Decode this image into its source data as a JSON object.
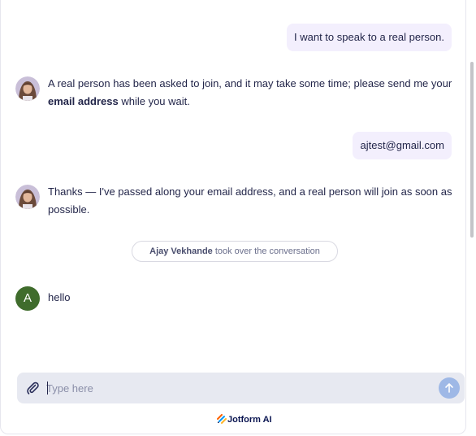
{
  "messages": [
    {
      "sender": "user",
      "text": "I want to speak to a real person."
    },
    {
      "sender": "bot",
      "text_before": "A real person has been asked to join, and it may take some time; please send me your ",
      "text_bold": "email address",
      "text_after": " while you wait."
    },
    {
      "sender": "user",
      "text": "ajtest@gmail.com"
    },
    {
      "sender": "bot",
      "text": "Thanks — I've passed along your email address, and a real person will join as soon as possible."
    },
    {
      "sender": "system",
      "agent_name": "Ajay Vekhande",
      "text": " took over the conversation"
    },
    {
      "sender": "agent",
      "avatar_letter": "A",
      "text": "hello"
    }
  ],
  "composer": {
    "placeholder": "Type here",
    "value": ""
  },
  "footer": {
    "brand": "Jotform AI"
  },
  "icons": {
    "attach": "paperclip-icon",
    "send": "arrow-up-icon",
    "bot_avatar": "bot-avatar-photo",
    "brand_logo": "jotform-logo"
  },
  "colors": {
    "user_bubble": "#f3effd",
    "text": "#23264a",
    "agent_avatar": "#3f6c2c",
    "composer_bg": "#e7e9f1",
    "send_button": "#9eb8e6",
    "brand": "#0a1551"
  }
}
